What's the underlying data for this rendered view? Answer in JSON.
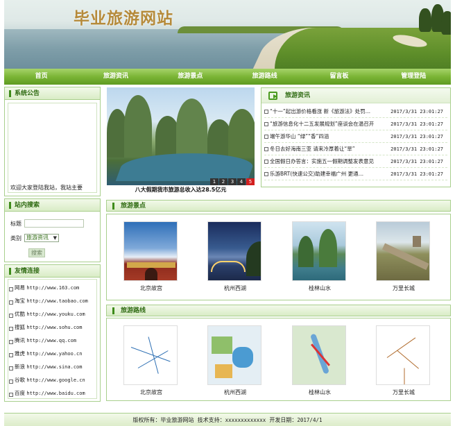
{
  "site": {
    "title": "毕业旅游网站"
  },
  "nav": {
    "items": [
      "首页",
      "旅游资讯",
      "旅游景点",
      "旅游路线",
      "留言板",
      "管理登陆"
    ]
  },
  "notice": {
    "title": "系统公告",
    "marquee": "欢迎大家登陆我站，我站主要"
  },
  "search": {
    "title": "站内搜索",
    "title_label": "标题",
    "title_value": "",
    "category_label": "类别",
    "category_selected": "旅游资讯",
    "button": "搜索"
  },
  "links": {
    "title": "友情连接",
    "items": [
      {
        "name": "网易",
        "url": "http://www.163.com"
      },
      {
        "name": "淘宝",
        "url": "http://www.taobao.com"
      },
      {
        "name": "优酷",
        "url": "http://www.youku.com"
      },
      {
        "name": "搜狐",
        "url": "http://www.sohu.com"
      },
      {
        "name": "腾讯",
        "url": "http://www.qq.com"
      },
      {
        "name": "雅虎",
        "url": "http://www.yahoo.cn"
      },
      {
        "name": "新浪",
        "url": "http://www.sina.com"
      },
      {
        "name": "谷歌",
        "url": "http://www.google.cn"
      },
      {
        "name": "百度",
        "url": "http://www.baidu.com"
      }
    ]
  },
  "slideshow": {
    "caption": "八大假期我市旅游总收入达28.5亿元",
    "pages": [
      "1",
      "2",
      "3",
      "4",
      "5"
    ],
    "active_page": "5"
  },
  "news": {
    "title": "旅游资讯",
    "items": [
      {
        "title": "“十一”起出游价格看涨 新《旅游法》处罚…",
        "date": "2017/3/31 23:01:27"
      },
      {
        "title": "“旅游信息化十二五发展规划”座谈会在温召开",
        "date": "2017/3/31 23:01:27"
      },
      {
        "title": "端午游华山 “绿”“香”四溢",
        "date": "2017/3/31 23:01:27"
      },
      {
        "title": "冬日去好海南三亚 请来冷厚着让“旱”",
        "date": "2017/3/31 23:01:27"
      },
      {
        "title": "全国假日办答言：实施五一假期调整发表意见",
        "date": "2017/3/31 23:01:27"
      },
      {
        "title": "乐游BRT(快速公交)助建幸福广州 更通…",
        "date": "2017/3/31 23:01:27"
      }
    ]
  },
  "scenic": {
    "title": "旅游景点",
    "items": [
      {
        "name": "北京故宫",
        "icon": "forbidden-city-photo"
      },
      {
        "name": "杭州西湖",
        "icon": "west-lake-photo"
      },
      {
        "name": "桂林山水",
        "icon": "guilin-photo"
      },
      {
        "name": "万里长城",
        "icon": "great-wall-photo"
      }
    ]
  },
  "routes": {
    "title": "旅游路线",
    "items": [
      {
        "name": "北京故宫",
        "icon": "beijing-route-map"
      },
      {
        "name": "杭州西湖",
        "icon": "hangzhou-route-map"
      },
      {
        "name": "桂林山水",
        "icon": "guilin-route-map"
      },
      {
        "name": "万里长城",
        "icon": "great-wall-route-map"
      }
    ]
  },
  "footer": {
    "copyright_label": "版权所有：",
    "copyright_value": "毕业旅游网站",
    "support_label": "技术支持：",
    "support_value": "xxxxxxxxxxxxx",
    "date_label": "开发日期：",
    "date_value": "2017/4/1"
  },
  "colors": {
    "nav": "#7bb536",
    "title": "#b58a3a",
    "border": "#a8cf8c",
    "accent": "#2f6b12"
  }
}
